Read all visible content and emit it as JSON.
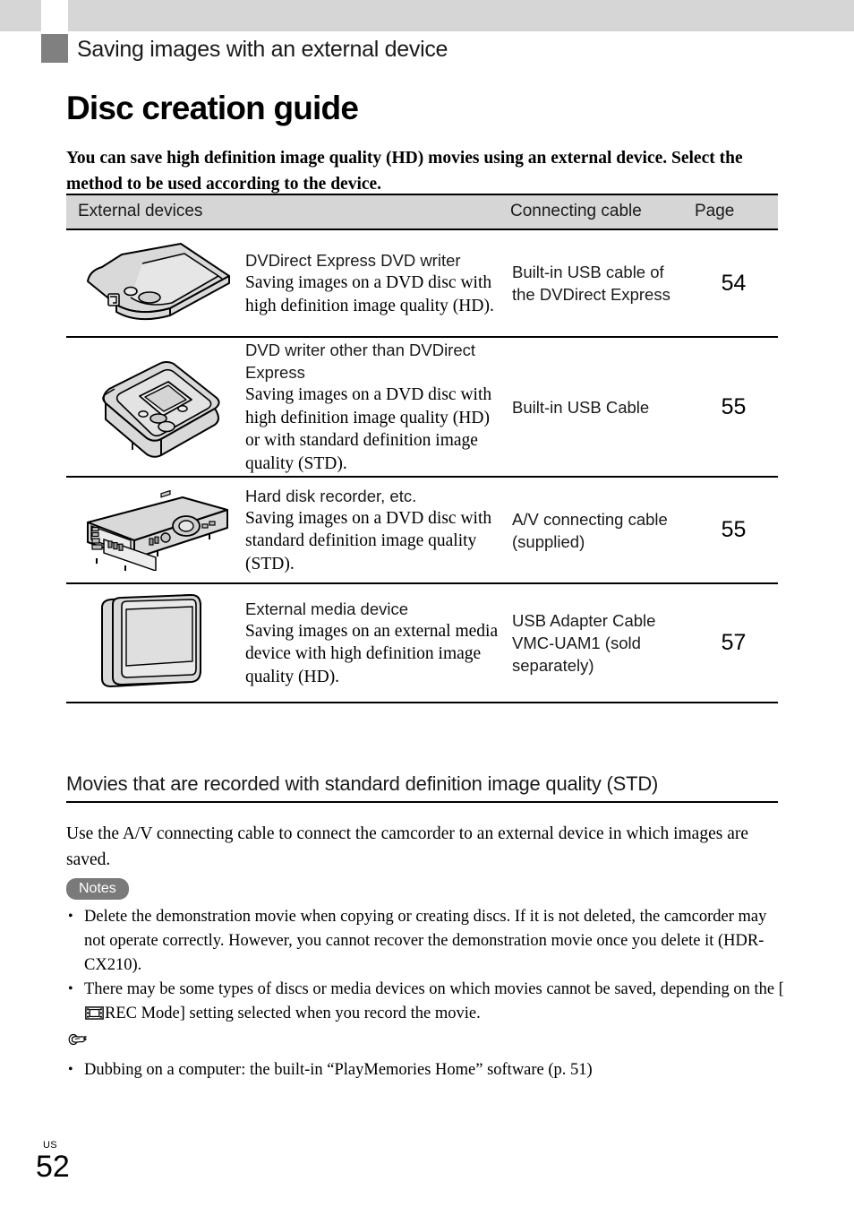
{
  "header": {
    "section_label": "Saving images with an external device",
    "page_title": "Disc creation guide",
    "intro": "You can save high definition image quality (HD) movies using an external device. Select the method to be used according to the device."
  },
  "table": {
    "columns": {
      "devices": "External devices",
      "cable": "Connecting cable",
      "page": "Page"
    },
    "rows": [
      {
        "icon": "dvdirect-express-dvd-writer-illustration",
        "title": "DVDirect Express DVD writer",
        "body": "Saving images on a DVD disc with high definition image quality (HD).",
        "cable": "Built-in USB cable of the DVDirect Express",
        "page": "54"
      },
      {
        "icon": "dvd-writer-illustration",
        "title": "DVD writer other than DVDirect Express",
        "body": "Saving images on a DVD disc with high definition image quality (HD) or with standard definition image quality (STD).",
        "cable": "Built-in USB Cable",
        "page": "55"
      },
      {
        "icon": "hard-disk-recorder-illustration",
        "title": "Hard disk recorder, etc.",
        "body": "Saving images on a DVD disc with standard definition image quality (STD).",
        "cable": "A/V connecting cable (supplied)",
        "page": "55"
      },
      {
        "icon": "external-media-device-illustration",
        "title": "External media device",
        "body": "Saving images on an external media device with high definition image quality (HD).",
        "cable": "USB Adapter Cable VMC-UAM1 (sold separately)",
        "page": "57"
      }
    ]
  },
  "subsection": {
    "title": "Movies that are recorded with standard definition image quality (STD)",
    "body": "Use the A/V connecting cable to connect the camcorder to an external device in which images are saved."
  },
  "notes": {
    "badge": "Notes",
    "items": [
      "Delete the demonstration movie when copying or creating discs. If it is not deleted, the camcorder may not operate correctly. However, you cannot recover the demonstration movie once you delete it (HDR-CX210)."
    ],
    "rec_mode_item": {
      "before": "There may be some types of discs or media devices on which movies cannot be saved, depending on the [",
      "after": "REC Mode] setting selected when you record the movie.",
      "icon": "film-strip-icon"
    },
    "hand_icon": "pointing-hand-icon",
    "reference_item": "Dubbing on a computer: the built-in “PlayMemories Home” software (p. 51)"
  },
  "footer": {
    "region": "US",
    "page_number": "52"
  },
  "colors": {
    "top_band": "#d6d6d6",
    "section_marker": "#808080",
    "table_header_bg": "#d6d6d6",
    "notes_badge_bg": "#7a7a7a",
    "device_fill": "#d9d9d9"
  }
}
